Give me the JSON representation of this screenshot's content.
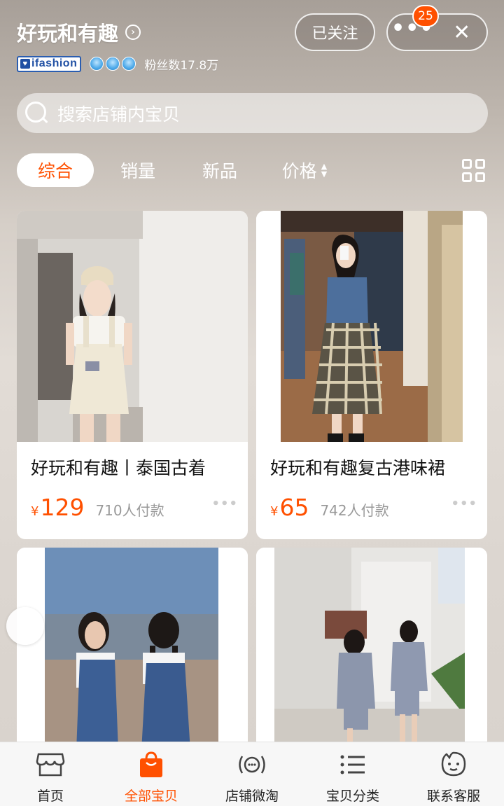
{
  "header": {
    "shop_name": "好玩和有趣",
    "brand_badge": "ifashion",
    "fans_text": "粉丝数17.8万",
    "follow_label": "已关注",
    "notification_count": "25"
  },
  "search": {
    "placeholder": "搜索店铺内宝贝"
  },
  "sort_tabs": [
    {
      "label": "综合",
      "active": true
    },
    {
      "label": "销量",
      "active": false
    },
    {
      "label": "新品",
      "active": false
    },
    {
      "label": "价格",
      "active": false
    }
  ],
  "products": [
    {
      "title": "好玩和有趣丨泰国古着",
      "currency": "¥",
      "price": "129",
      "sold": "710人付款"
    },
    {
      "title": "好玩和有趣复古港味裙",
      "currency": "¥",
      "price": "65",
      "sold": "742人付款"
    }
  ],
  "bottom_nav": [
    {
      "label": "首页",
      "icon": "storefront-icon",
      "active": false
    },
    {
      "label": "全部宝贝",
      "icon": "shopping-bag-icon",
      "active": true
    },
    {
      "label": "店铺微淘",
      "icon": "broadcast-icon",
      "active": false
    },
    {
      "label": "宝贝分类",
      "icon": "list-icon",
      "active": false
    },
    {
      "label": "联系客服",
      "icon": "chat-face-icon",
      "active": false
    }
  ],
  "colors": {
    "accent": "#ff5000",
    "brand_blue": "#1f4fa3"
  }
}
